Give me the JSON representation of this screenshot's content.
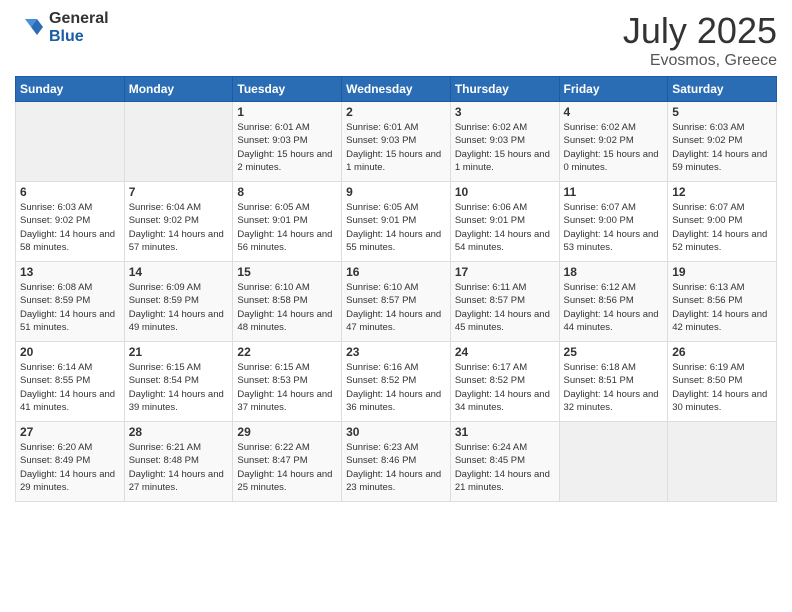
{
  "logo": {
    "general": "General",
    "blue": "Blue"
  },
  "header": {
    "month_year": "July 2025",
    "location": "Evosmos, Greece"
  },
  "weekdays": [
    "Sunday",
    "Monday",
    "Tuesday",
    "Wednesday",
    "Thursday",
    "Friday",
    "Saturday"
  ],
  "weeks": [
    [
      {
        "day": "",
        "sunrise": "",
        "sunset": "",
        "daylight": ""
      },
      {
        "day": "",
        "sunrise": "",
        "sunset": "",
        "daylight": ""
      },
      {
        "day": "1",
        "sunrise": "Sunrise: 6:01 AM",
        "sunset": "Sunset: 9:03 PM",
        "daylight": "Daylight: 15 hours and 2 minutes."
      },
      {
        "day": "2",
        "sunrise": "Sunrise: 6:01 AM",
        "sunset": "Sunset: 9:03 PM",
        "daylight": "Daylight: 15 hours and 1 minute."
      },
      {
        "day": "3",
        "sunrise": "Sunrise: 6:02 AM",
        "sunset": "Sunset: 9:03 PM",
        "daylight": "Daylight: 15 hours and 1 minute."
      },
      {
        "day": "4",
        "sunrise": "Sunrise: 6:02 AM",
        "sunset": "Sunset: 9:02 PM",
        "daylight": "Daylight: 15 hours and 0 minutes."
      },
      {
        "day": "5",
        "sunrise": "Sunrise: 6:03 AM",
        "sunset": "Sunset: 9:02 PM",
        "daylight": "Daylight: 14 hours and 59 minutes."
      }
    ],
    [
      {
        "day": "6",
        "sunrise": "Sunrise: 6:03 AM",
        "sunset": "Sunset: 9:02 PM",
        "daylight": "Daylight: 14 hours and 58 minutes."
      },
      {
        "day": "7",
        "sunrise": "Sunrise: 6:04 AM",
        "sunset": "Sunset: 9:02 PM",
        "daylight": "Daylight: 14 hours and 57 minutes."
      },
      {
        "day": "8",
        "sunrise": "Sunrise: 6:05 AM",
        "sunset": "Sunset: 9:01 PM",
        "daylight": "Daylight: 14 hours and 56 minutes."
      },
      {
        "day": "9",
        "sunrise": "Sunrise: 6:05 AM",
        "sunset": "Sunset: 9:01 PM",
        "daylight": "Daylight: 14 hours and 55 minutes."
      },
      {
        "day": "10",
        "sunrise": "Sunrise: 6:06 AM",
        "sunset": "Sunset: 9:01 PM",
        "daylight": "Daylight: 14 hours and 54 minutes."
      },
      {
        "day": "11",
        "sunrise": "Sunrise: 6:07 AM",
        "sunset": "Sunset: 9:00 PM",
        "daylight": "Daylight: 14 hours and 53 minutes."
      },
      {
        "day": "12",
        "sunrise": "Sunrise: 6:07 AM",
        "sunset": "Sunset: 9:00 PM",
        "daylight": "Daylight: 14 hours and 52 minutes."
      }
    ],
    [
      {
        "day": "13",
        "sunrise": "Sunrise: 6:08 AM",
        "sunset": "Sunset: 8:59 PM",
        "daylight": "Daylight: 14 hours and 51 minutes."
      },
      {
        "day": "14",
        "sunrise": "Sunrise: 6:09 AM",
        "sunset": "Sunset: 8:59 PM",
        "daylight": "Daylight: 14 hours and 49 minutes."
      },
      {
        "day": "15",
        "sunrise": "Sunrise: 6:10 AM",
        "sunset": "Sunset: 8:58 PM",
        "daylight": "Daylight: 14 hours and 48 minutes."
      },
      {
        "day": "16",
        "sunrise": "Sunrise: 6:10 AM",
        "sunset": "Sunset: 8:57 PM",
        "daylight": "Daylight: 14 hours and 47 minutes."
      },
      {
        "day": "17",
        "sunrise": "Sunrise: 6:11 AM",
        "sunset": "Sunset: 8:57 PM",
        "daylight": "Daylight: 14 hours and 45 minutes."
      },
      {
        "day": "18",
        "sunrise": "Sunrise: 6:12 AM",
        "sunset": "Sunset: 8:56 PM",
        "daylight": "Daylight: 14 hours and 44 minutes."
      },
      {
        "day": "19",
        "sunrise": "Sunrise: 6:13 AM",
        "sunset": "Sunset: 8:56 PM",
        "daylight": "Daylight: 14 hours and 42 minutes."
      }
    ],
    [
      {
        "day": "20",
        "sunrise": "Sunrise: 6:14 AM",
        "sunset": "Sunset: 8:55 PM",
        "daylight": "Daylight: 14 hours and 41 minutes."
      },
      {
        "day": "21",
        "sunrise": "Sunrise: 6:15 AM",
        "sunset": "Sunset: 8:54 PM",
        "daylight": "Daylight: 14 hours and 39 minutes."
      },
      {
        "day": "22",
        "sunrise": "Sunrise: 6:15 AM",
        "sunset": "Sunset: 8:53 PM",
        "daylight": "Daylight: 14 hours and 37 minutes."
      },
      {
        "day": "23",
        "sunrise": "Sunrise: 6:16 AM",
        "sunset": "Sunset: 8:52 PM",
        "daylight": "Daylight: 14 hours and 36 minutes."
      },
      {
        "day": "24",
        "sunrise": "Sunrise: 6:17 AM",
        "sunset": "Sunset: 8:52 PM",
        "daylight": "Daylight: 14 hours and 34 minutes."
      },
      {
        "day": "25",
        "sunrise": "Sunrise: 6:18 AM",
        "sunset": "Sunset: 8:51 PM",
        "daylight": "Daylight: 14 hours and 32 minutes."
      },
      {
        "day": "26",
        "sunrise": "Sunrise: 6:19 AM",
        "sunset": "Sunset: 8:50 PM",
        "daylight": "Daylight: 14 hours and 30 minutes."
      }
    ],
    [
      {
        "day": "27",
        "sunrise": "Sunrise: 6:20 AM",
        "sunset": "Sunset: 8:49 PM",
        "daylight": "Daylight: 14 hours and 29 minutes."
      },
      {
        "day": "28",
        "sunrise": "Sunrise: 6:21 AM",
        "sunset": "Sunset: 8:48 PM",
        "daylight": "Daylight: 14 hours and 27 minutes."
      },
      {
        "day": "29",
        "sunrise": "Sunrise: 6:22 AM",
        "sunset": "Sunset: 8:47 PM",
        "daylight": "Daylight: 14 hours and 25 minutes."
      },
      {
        "day": "30",
        "sunrise": "Sunrise: 6:23 AM",
        "sunset": "Sunset: 8:46 PM",
        "daylight": "Daylight: 14 hours and 23 minutes."
      },
      {
        "day": "31",
        "sunrise": "Sunrise: 6:24 AM",
        "sunset": "Sunset: 8:45 PM",
        "daylight": "Daylight: 14 hours and 21 minutes."
      },
      {
        "day": "",
        "sunrise": "",
        "sunset": "",
        "daylight": ""
      },
      {
        "day": "",
        "sunrise": "",
        "sunset": "",
        "daylight": ""
      }
    ]
  ]
}
